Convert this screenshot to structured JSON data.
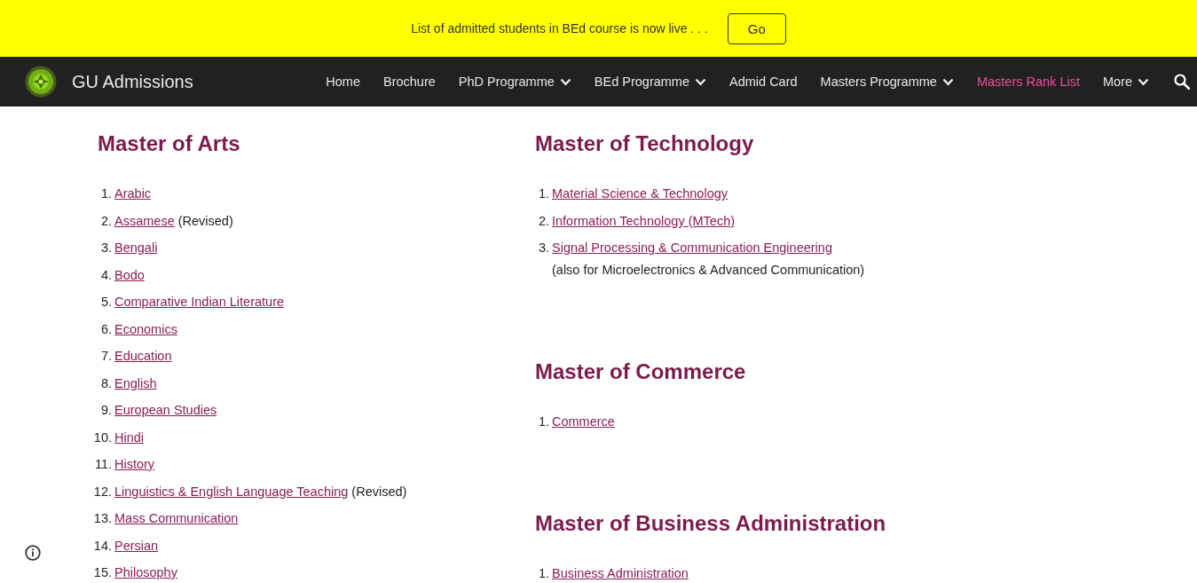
{
  "banner": {
    "message": "List of admitted students in BEd course is now live . . .",
    "button": "Go"
  },
  "site": {
    "title": "GU Admissions"
  },
  "nav": [
    {
      "label": "Home",
      "dropdown": false,
      "selected": false
    },
    {
      "label": "Brochure",
      "dropdown": false,
      "selected": false
    },
    {
      "label": "PhD Programme",
      "dropdown": true,
      "selected": false
    },
    {
      "label": "BEd Programme",
      "dropdown": true,
      "selected": false
    },
    {
      "label": "Admid Card",
      "dropdown": false,
      "selected": false
    },
    {
      "label": "Masters Programme",
      "dropdown": true,
      "selected": false
    },
    {
      "label": "Masters Rank List",
      "dropdown": false,
      "selected": true
    },
    {
      "label": "More",
      "dropdown": true,
      "selected": false
    }
  ],
  "columns": [
    {
      "sections": [
        {
          "heading": "Master of Arts",
          "items": [
            {
              "number": "1.",
              "link": "Arabic"
            },
            {
              "number": "2.",
              "link": "Assamese",
              "note": "(Revised)"
            },
            {
              "number": "3.",
              "link": "Bengali"
            },
            {
              "number": "4.",
              "link": "Bodo"
            },
            {
              "number": "5.",
              "link": "Comparative Indian Literature"
            },
            {
              "number": "6.",
              "link": "Economics"
            },
            {
              "number": "7.",
              "link": "Education"
            },
            {
              "number": "8.",
              "link": "English"
            },
            {
              "number": "9.",
              "link": "European Studies"
            },
            {
              "number": "10.",
              "link": "Hindi"
            },
            {
              "number": "11.",
              "link": "History"
            },
            {
              "number": "12.",
              "link": "Linguistics & English Language Teaching",
              "note": "(Revised)"
            },
            {
              "number": "13.",
              "link": "Mass Communication"
            },
            {
              "number": "14.",
              "link": "Persian"
            },
            {
              "number": "15.",
              "link": "Philosophy"
            }
          ]
        }
      ]
    },
    {
      "sections": [
        {
          "heading": "Master of Technology",
          "items": [
            {
              "number": "1.",
              "link": "Material Science & Technology"
            },
            {
              "number": "2.",
              "link": "Information Technology (MTech)"
            },
            {
              "number": "3.",
              "link": "Signal Processing & Communication Engineering",
              "detail": "(also for Microelectronics & Advanced Communication)"
            }
          ]
        },
        {
          "heading": "Master of Commerce",
          "items": [
            {
              "number": "1.",
              "link": "Commerce"
            }
          ]
        },
        {
          "heading": "Master of Business Administration",
          "items": [
            {
              "number": "1.",
              "link": "Business Administration"
            }
          ]
        }
      ]
    }
  ]
}
